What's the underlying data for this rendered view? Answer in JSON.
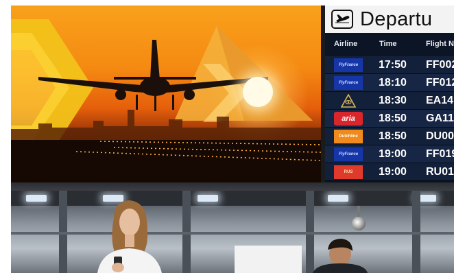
{
  "board": {
    "title": "Departu",
    "columns": [
      "Airline",
      "Time",
      "Flight N"
    ],
    "flights": [
      {
        "airline": "FlyFrance",
        "time": "17:50",
        "flight": "FF002",
        "logo": "flyfrance"
      },
      {
        "airline": "FlyFrance",
        "time": "18:10",
        "flight": "FF012",
        "logo": "flyfrance"
      },
      {
        "airline": "",
        "time": "18:30",
        "flight": "EA14",
        "logo": "egypt"
      },
      {
        "airline": "aria",
        "time": "18:50",
        "flight": "GA11",
        "logo": "aria"
      },
      {
        "airline": "Dutchline",
        "time": "18:50",
        "flight": "DU00",
        "logo": "dutch"
      },
      {
        "airline": "FlyFrance",
        "time": "19:00",
        "flight": "FF019",
        "logo": "flyfrance"
      },
      {
        "airline": "RUS",
        "time": "19:00",
        "flight": "RU01",
        "logo": "rus"
      }
    ]
  },
  "icons": {
    "header": "airplane-departure-icon",
    "egypt_logo": "pyramid-eye-icon"
  },
  "colors": {
    "board_bg": "#0b1120",
    "row_bg": "#13203a",
    "header_bg": "#f3f3f3",
    "ad_sky": "#f58a12",
    "chevron": "#f2c21a"
  }
}
